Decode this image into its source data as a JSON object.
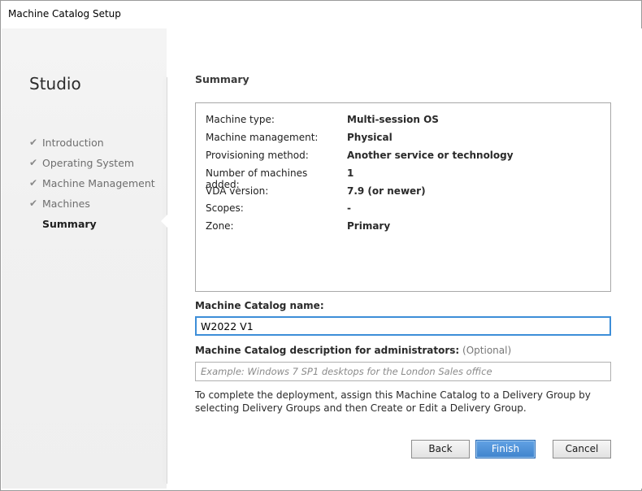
{
  "window": {
    "title": "Machine Catalog Setup"
  },
  "sidebar": {
    "app_name": "Studio",
    "steps": [
      {
        "label": "Introduction",
        "done": true
      },
      {
        "label": "Operating System",
        "done": true
      },
      {
        "label": "Machine Management",
        "done": true
      },
      {
        "label": "Machines",
        "done": true
      },
      {
        "label": "Summary",
        "done": false,
        "active": true
      }
    ],
    "check_glyph": "✔"
  },
  "main": {
    "section_title": "Summary",
    "summary": [
      {
        "key": "Machine type:",
        "value": "Multi-session OS"
      },
      {
        "key": "Machine management:",
        "value": "Physical"
      },
      {
        "key": "Provisioning method:",
        "value": "Another service or technology"
      },
      {
        "key": "Number of machines added:",
        "value": "1"
      },
      {
        "key": "VDA version:",
        "value": "7.9 (or newer)"
      },
      {
        "key": "Scopes:",
        "value": "-"
      },
      {
        "key": "Zone:",
        "value": "Primary"
      }
    ],
    "catalog_name_label": "Machine Catalog name:",
    "catalog_name_value": "W2022 V1",
    "description_label": "Machine Catalog description for administrators:",
    "description_optional": "(Optional)",
    "description_placeholder": "Example: Windows 7 SP1 desktops for the London Sales office",
    "description_value": "",
    "hint": "To complete the deployment, assign this Machine Catalog to a Delivery Group by selecting Delivery Groups and then Create or Edit a Delivery Group."
  },
  "buttons": {
    "back": "Back",
    "finish": "Finish",
    "cancel": "Cancel"
  },
  "colors": {
    "accent": "#3f83cc",
    "focus_border": "#3d8ed8"
  }
}
